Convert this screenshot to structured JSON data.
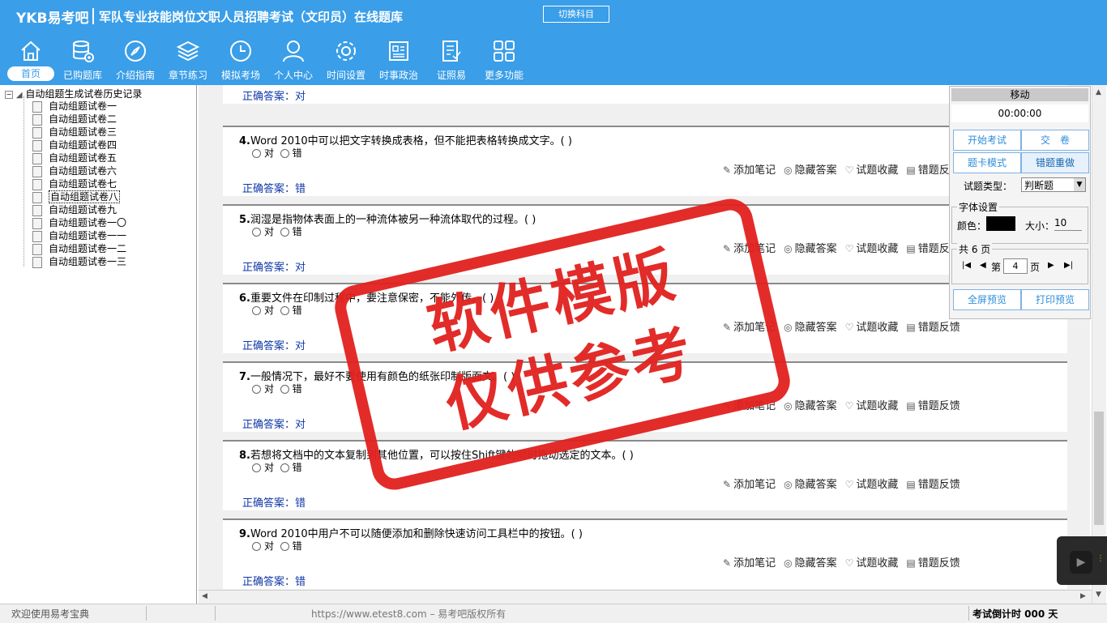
{
  "header": {
    "logo": "YKB易考吧",
    "title": "军队专业技能岗位文职人员招聘考试（文印员）在线题库",
    "switch_button": "切换科目"
  },
  "nav": [
    {
      "label": "首页",
      "icon": "home-icon"
    },
    {
      "label": "已购题库",
      "icon": "database-icon"
    },
    {
      "label": "介绍指南",
      "icon": "compass-icon"
    },
    {
      "label": "章节练习",
      "icon": "layers-icon"
    },
    {
      "label": "模拟考场",
      "icon": "clock-icon"
    },
    {
      "label": "个人中心",
      "icon": "user-icon"
    },
    {
      "label": "时间设置",
      "icon": "gear-icon"
    },
    {
      "label": "时事政治",
      "icon": "newspaper-icon"
    },
    {
      "label": "证照易",
      "icon": "checklist-icon"
    },
    {
      "label": "更多功能",
      "icon": "grid-icon"
    }
  ],
  "tree": {
    "root": "自动组题生成试卷历史记录",
    "items": [
      "自动组题试卷一",
      "自动组题试卷二",
      "自动组题试卷三",
      "自动组题试卷四",
      "自动组题试卷五",
      "自动组题试卷六",
      "自动组题试卷七",
      "自动组题试卷八",
      "自动组题试卷九",
      "自动组题试卷一〇",
      "自动组题试卷一一",
      "自动组题试卷一二",
      "自动组题试卷一三"
    ],
    "selected_index": 7
  },
  "question_common": {
    "option_true": "对",
    "option_false": "错",
    "answer_prefix": "正确答案：",
    "add_note": "添加笔记",
    "hide_answer": "隐藏答案",
    "favorite": "试题收藏",
    "report_error": "错题反馈"
  },
  "questions": [
    {
      "num": "",
      "text": "",
      "answer": "对"
    },
    {
      "num": "4.",
      "text": "Word 2010中可以把文字转换成表格，但不能把表格转换成文字。( )",
      "answer": "错"
    },
    {
      "num": "5.",
      "text": "润湿是指物体表面上的一种流体被另一种流体取代的过程。( )",
      "answer": "对"
    },
    {
      "num": "6.",
      "text": "重要文件在印制过程中，要注意保密，不能外传。( )",
      "answer": "对"
    },
    {
      "num": "7.",
      "text": "一般情况下，最好不要使用有颜色的纸张印制版面文。( )",
      "answer": "对"
    },
    {
      "num": "8.",
      "text": "若想将文档中的文本复制到其他位置，可以按住Shift键的同时拖动选定的文本。( )",
      "answer": "错"
    },
    {
      "num": "9.",
      "text": "Word 2010中用户不可以随便添加和删除快速访问工具栏中的按钮。( )",
      "answer": "错"
    }
  ],
  "right_panel": {
    "title": "移动",
    "timer": "00:00:00",
    "start_exam": "开始考试",
    "submit": "交　卷",
    "card_mode": "题卡模式",
    "redo_wrong": "错题重做",
    "type_label": "试题类型：",
    "type_value": "判断题",
    "font_group": "字体设置",
    "color_label": "颜色：",
    "size_label": "大小：",
    "size_value": "10",
    "pages_group": "共 6 页",
    "page_prefix": "第",
    "page_value": "4",
    "page_suffix": "页",
    "fullscreen": "全屏预览",
    "print": "打印预览"
  },
  "status": {
    "left": "欢迎使用易考宝典",
    "center": "https://www.etest8.com – 易考吧版权所有",
    "right": "考试倒计时 000 天"
  },
  "watermark": {
    "line1": "软件模版",
    "line2": "仅供参考"
  },
  "colors": {
    "header": "#3a9ee8",
    "answer": "#0f37a8",
    "stamp": "#e1211e"
  }
}
